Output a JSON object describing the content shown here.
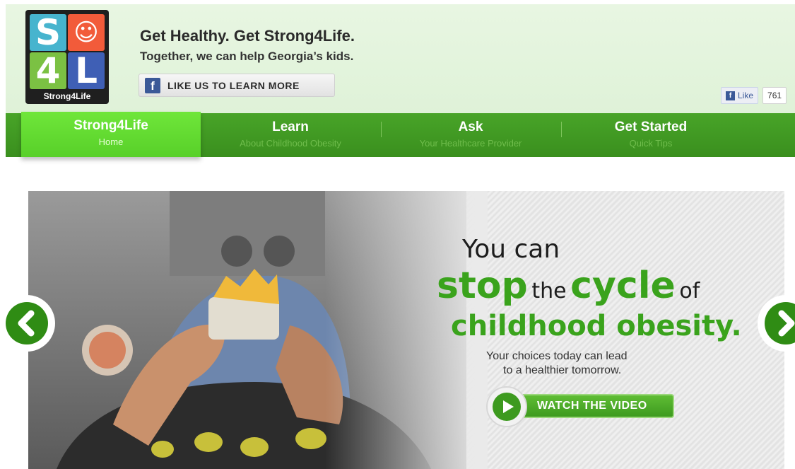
{
  "header": {
    "logo": {
      "letters": [
        "S",
        "☺",
        "4",
        "L"
      ],
      "brand": "Strong4Life"
    },
    "headline": "Get Healthy. Get Strong4Life.",
    "subline": "Together, we can help Georgia’s kids.",
    "fb_button_label": "LIKE US TO LEARN MORE",
    "fb_social": {
      "like_label": "Like",
      "count": "761"
    }
  },
  "nav": {
    "items": [
      {
        "title": "Strong4Life",
        "subtitle": "Home"
      },
      {
        "title": "Learn",
        "subtitle": "About Childhood Obesity"
      },
      {
        "title": "Ask",
        "subtitle": "Your Healthcare Provider"
      },
      {
        "title": "Get Started",
        "subtitle": "Quick Tips"
      }
    ]
  },
  "hero": {
    "line1": "You can",
    "line2": {
      "w1": "stop",
      "w2": "the",
      "w3": "cycle",
      "w4": "of"
    },
    "line3": "childhood obesity.",
    "tagline": [
      "Your choices today can lead",
      "to a healthier tomorrow."
    ],
    "cta_label": "WATCH THE VIDEO"
  },
  "colors": {
    "brand_green": "#3aa31c",
    "nav_green": "#3f961f",
    "active_tab": "#62da30",
    "facebook_blue": "#3b5998"
  },
  "icons": {
    "prev": "chevron-left-icon",
    "next": "chevron-right-icon",
    "play": "play-icon",
    "facebook": "facebook-icon"
  }
}
